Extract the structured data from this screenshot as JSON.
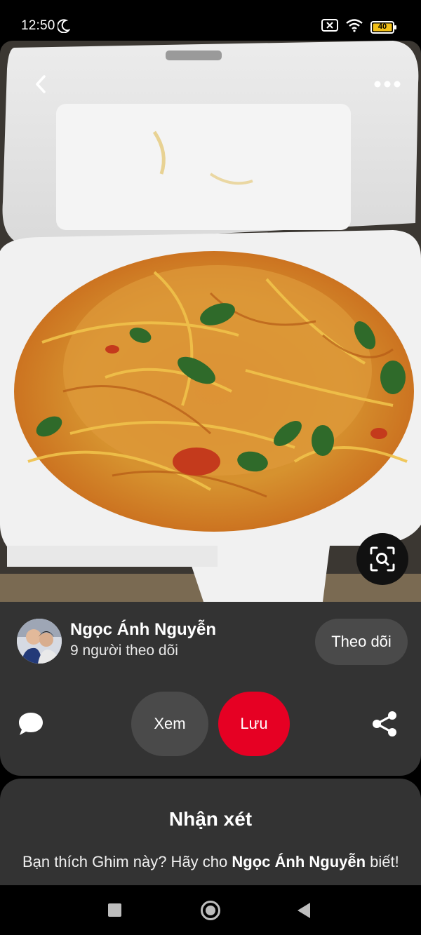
{
  "status_bar": {
    "time": "12:50",
    "battery_level": "40",
    "icons": [
      "moon-icon",
      "no-sim-icon",
      "wifi-icon",
      "battery-icon"
    ]
  },
  "pin": {
    "image_description_icon": "food-photo",
    "back_icon": "chevron-left-icon",
    "more_icon": "more-horizontal-icon",
    "lens_icon": "visual-search-icon"
  },
  "creator": {
    "name": "Ngọc Ánh Nguyễn",
    "followers": "9 người theo dõi",
    "follow_label": "Theo dõi"
  },
  "actions": {
    "view_label": "Xem",
    "save_label": "Lưu",
    "comment_icon": "comment-icon",
    "share_icon": "share-icon"
  },
  "comments": {
    "title": "Nhận xét",
    "prompt_prefix": "Bạn thích Ghim này? Hãy cho ",
    "prompt_name": "Ngọc Ánh Nguyễn",
    "prompt_suffix": "biết!"
  },
  "colors": {
    "accent": "#e60023",
    "panel": "#333333",
    "button": "#4a4a4a"
  }
}
